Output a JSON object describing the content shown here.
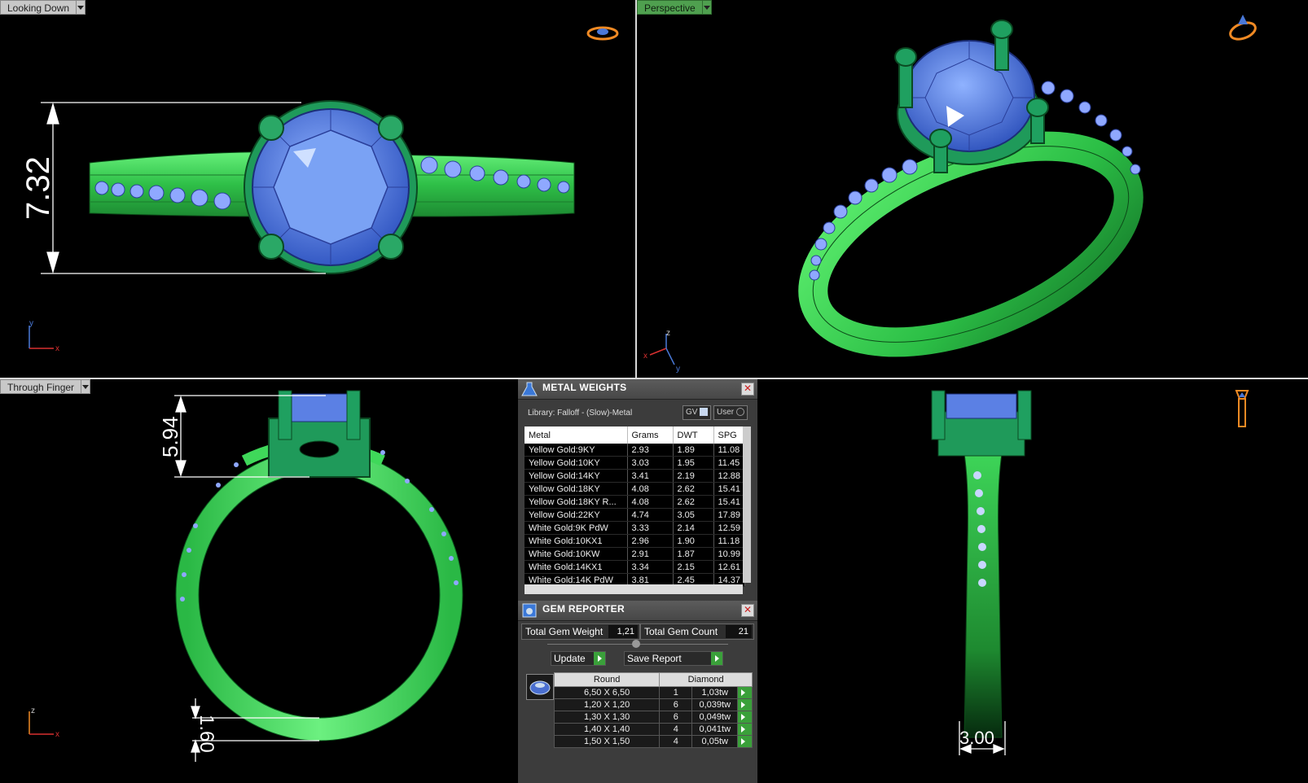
{
  "viewports": {
    "top_left": {
      "label": "Looking Down",
      "dimension": "7.32",
      "axis_x": "x",
      "axis_y": "y"
    },
    "top_right": {
      "label": "Perspective",
      "axis_x": "x",
      "axis_y": "y",
      "axis_z": "z"
    },
    "bottom_left": {
      "label": "Through Finger",
      "dimension_top": "5.94",
      "dimension_bottom": "1.60",
      "axis_x": "x",
      "axis_z": "z"
    },
    "bottom_right": {
      "dimension": "3.00"
    }
  },
  "metal_weights": {
    "title": "METAL WEIGHTS",
    "library": "Library: Falloff - (Slow)-Metal",
    "gv_label": "GV",
    "user_label": "User",
    "columns": [
      "Metal",
      "Grams",
      "DWT",
      "SPG"
    ],
    "rows": [
      [
        "Yellow Gold:9KY",
        "2.93",
        "1.89",
        "11.08"
      ],
      [
        "Yellow Gold:10KY",
        "3.03",
        "1.95",
        "11.45"
      ],
      [
        "Yellow Gold:14KY",
        "3.41",
        "2.19",
        "12.88"
      ],
      [
        "Yellow Gold:18KY",
        "4.08",
        "2.62",
        "15.41"
      ],
      [
        "Yellow Gold:18KY R...",
        "4.08",
        "2.62",
        "15.41"
      ],
      [
        "Yellow Gold:22KY",
        "4.74",
        "3.05",
        "17.89"
      ],
      [
        "White Gold:9K PdW",
        "3.33",
        "2.14",
        "12.59"
      ],
      [
        "White Gold:10KX1",
        "2.96",
        "1.90",
        "11.18"
      ],
      [
        "White Gold:10KW",
        "2.91",
        "1.87",
        "10.99"
      ],
      [
        "White Gold:14KX1",
        "3.34",
        "2.15",
        "12.61"
      ],
      [
        "White Gold:14K PdW",
        "3.81",
        "2.45",
        "14.37"
      ]
    ]
  },
  "gem_reporter": {
    "title": "GEM REPORTER",
    "total_weight_label": "Total Gem Weight",
    "total_weight_value": "1,21",
    "total_count_label": "Total Gem Count",
    "total_count_value": "21",
    "update_label": "Update",
    "save_label": "Save Report",
    "shape_header": "Round",
    "type_header": "Diamond",
    "rows": [
      [
        "6,50 X 6,50",
        "1",
        "1,03tw"
      ],
      [
        "1,20 X 1,20",
        "6",
        "0,039tw"
      ],
      [
        "1,30 X 1,30",
        "6",
        "0,049tw"
      ],
      [
        "1,40 X 1,40",
        "4",
        "0,041tw"
      ],
      [
        "1,50 X 1,50",
        "4",
        "0,05tw"
      ]
    ]
  },
  "colors": {
    "metal": "#3fd85a",
    "gem": "#5b8ee8",
    "prong": "#1f9a5a",
    "active_label": "#4fa04f"
  }
}
